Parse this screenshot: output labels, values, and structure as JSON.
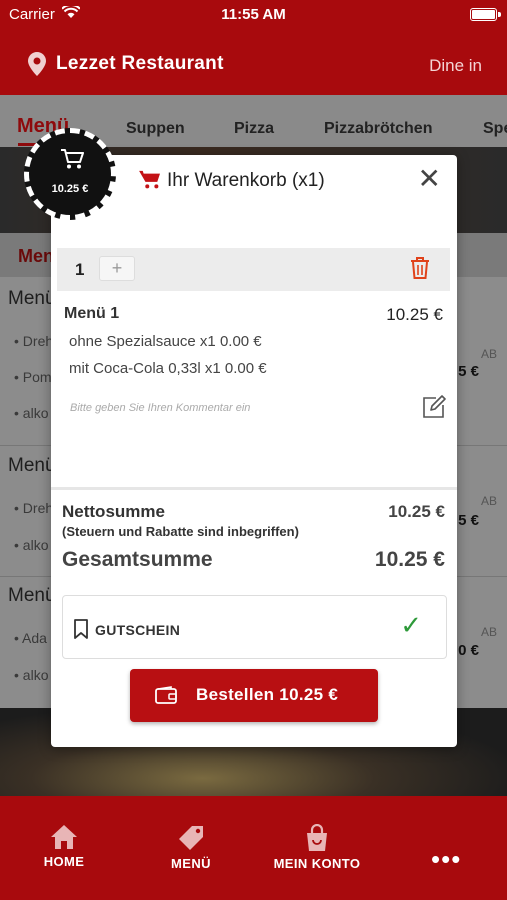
{
  "status_bar": {
    "carrier": "Carrier",
    "time": "11:55 AM"
  },
  "header": {
    "restaurant_name": "Lezzet Restaurant",
    "mode": "Dine in"
  },
  "tabs": [
    {
      "label": "Menü",
      "active": true
    },
    {
      "label": "Suppen"
    },
    {
      "label": "Pizza"
    },
    {
      "label": "Pizzabrötchen"
    },
    {
      "label": "Spe"
    }
  ],
  "background_list": {
    "section_title": "Men",
    "rows": [
      {
        "title": "Menü",
        "subs": [
          "• Dreh",
          "• Pom",
          "• alko"
        ],
        "price": "5 €",
        "badge": "AB"
      },
      {
        "title": "Menü",
        "subs": [
          "• Dreh",
          "• alko"
        ],
        "price": "5 €",
        "badge": "AB"
      },
      {
        "title": "Menü",
        "subs": [
          "• Ada",
          "• alko"
        ],
        "price": "0 €",
        "badge": "AB"
      }
    ]
  },
  "cart_badge": {
    "amount": "10.25 €"
  },
  "cart_modal": {
    "title": "Ihr Warenkorb (x1)",
    "item": {
      "quantity": "1",
      "plus": "+",
      "name": "Menü 1",
      "price": "10.25 €",
      "options": [
        "ohne Spezialsauce x1 0.00 €",
        "mit Coca-Cola 0,33l x1 0.00 €"
      ],
      "comment_placeholder": "Bitte geben Sie Ihren Kommentar ein"
    },
    "net_label": "Nettosumme",
    "net_value": "10.25 €",
    "net_note": "(Steuern und Rabatte sind inbegriffen)",
    "total_label": "Gesamtsumme",
    "total_value": "10.25 €",
    "voucher_label": "GUTSCHEIN",
    "order_button": "Bestellen 10.25 €"
  },
  "tabbar": [
    {
      "label": "HOME",
      "icon": "home-icon"
    },
    {
      "label": "MENÜ",
      "icon": "tag-icon"
    },
    {
      "label": "MEIN KONTO",
      "icon": "bag-icon"
    },
    {
      "label": "",
      "icon": "more-icon"
    }
  ],
  "colors": {
    "brand": "#a80a0d",
    "button": "#b80f12",
    "check": "#2e9a3a",
    "trash": "#e0421a"
  }
}
